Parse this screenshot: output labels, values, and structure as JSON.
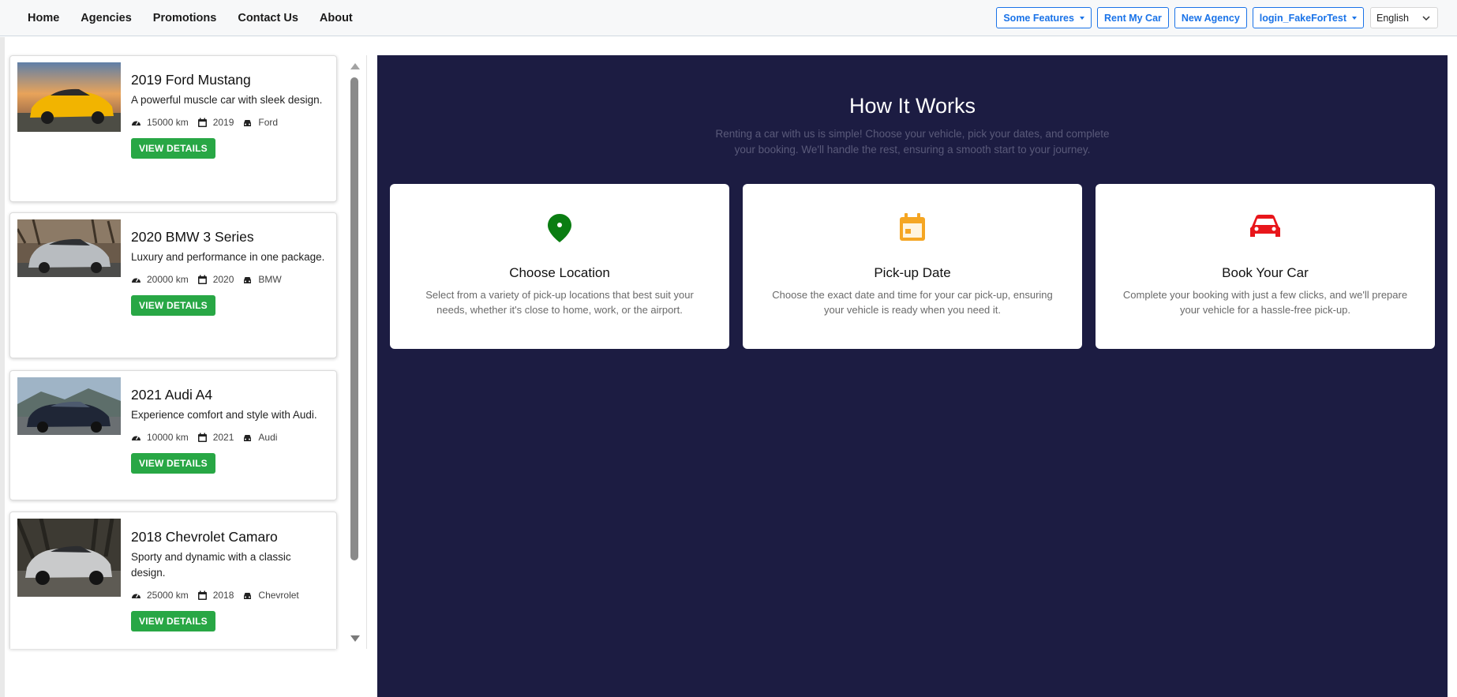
{
  "nav": {
    "links": [
      "Home",
      "Agencies",
      "Promotions",
      "Contact Us",
      "About"
    ],
    "buttons": {
      "features": "Some Features",
      "rent_my_car": "Rent My Car",
      "new_agency": "New Agency",
      "account": "login_FakeForTest"
    },
    "language": "English"
  },
  "cars": [
    {
      "title": "2019 Ford Mustang",
      "description": "A powerful muscle car with sleek design.",
      "mileage": "15000 km",
      "year": "2019",
      "brand": "Ford",
      "button": "VIEW DETAILS"
    },
    {
      "title": "2020 BMW 3 Series",
      "description": "Luxury and performance in one package.",
      "mileage": "20000 km",
      "year": "2020",
      "brand": "BMW",
      "button": "VIEW DETAILS"
    },
    {
      "title": "2021 Audi A4",
      "description": "Experience comfort and style with Audi.",
      "mileage": "10000 km",
      "year": "2021",
      "brand": "Audi",
      "button": "VIEW DETAILS"
    },
    {
      "title": "2018 Chevrolet Camaro",
      "description": "Sporty and dynamic with a classic design.",
      "mileage": "25000 km",
      "year": "2018",
      "brand": "Chevrolet",
      "button": "VIEW DETAILS"
    }
  ],
  "how_it_works": {
    "title": "How It Works",
    "subtitle": "Renting a car with us is simple! Choose your vehicle, pick your dates, and complete your booking. We'll handle the rest, ensuring a smooth start to your journey.",
    "steps": [
      {
        "icon": "map-pin-icon",
        "color": "#0a7d12",
        "title": "Choose Location",
        "description": "Select from a variety of pick-up locations that best suit your needs, whether it's close to home, work, or the airport."
      },
      {
        "icon": "calendar-icon",
        "color": "#f5a623",
        "title": "Pick-up Date",
        "description": "Choose the exact date and time for your car pick-up, ensuring your vehicle is ready when you need it."
      },
      {
        "icon": "car-icon",
        "color": "#e8161b",
        "title": "Book Your Car",
        "description": "Complete your booking with just a few clicks, and we'll prepare your vehicle for a hassle-free pick-up."
      }
    ]
  },
  "colors": {
    "accent": "#1a73e8",
    "button_green": "#28a745",
    "section_bg": "#1c1c42"
  }
}
